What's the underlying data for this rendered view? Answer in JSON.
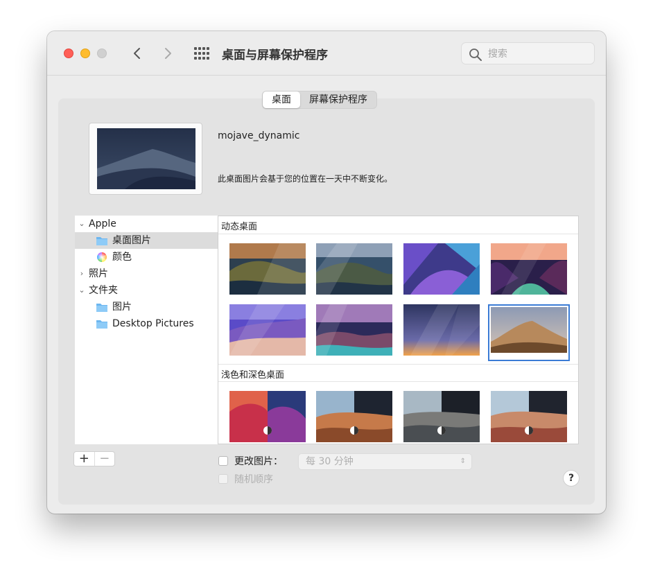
{
  "window": {
    "title": "桌面与屏幕保护程序",
    "search_placeholder": "搜索"
  },
  "tabs": [
    {
      "label": "桌面",
      "active": true
    },
    {
      "label": "屏幕保护程序",
      "active": false
    }
  ],
  "current": {
    "name": "mojave_dynamic",
    "description": "此桌面图片会基于您的位置在一天中不断变化。"
  },
  "sidebar": {
    "items": [
      {
        "label": "Apple",
        "kind": "group",
        "expanded": true,
        "icon": "chevron-down-icon"
      },
      {
        "label": "桌面图片",
        "kind": "folder",
        "selected": true,
        "icon": "folder-icon"
      },
      {
        "label": "颜色",
        "kind": "colors",
        "icon": "color-wheel-icon"
      },
      {
        "label": "照片",
        "kind": "group",
        "expanded": false,
        "icon": "chevron-right-icon"
      },
      {
        "label": "文件夹",
        "kind": "group",
        "expanded": true,
        "icon": "chevron-down-icon"
      },
      {
        "label": "图片",
        "kind": "folder",
        "icon": "folder-icon"
      },
      {
        "label": "Desktop Pictures",
        "kind": "folder",
        "icon": "folder-icon"
      }
    ]
  },
  "sections": [
    {
      "title": "动态桌面"
    },
    {
      "title": "浅色和深色桌面"
    }
  ],
  "footer": {
    "add_label": "+",
    "remove_label": "−",
    "change_picture_label": "更改图片：",
    "interval_value": "每 30 分钟",
    "random_order_label": "随机顺序",
    "help_label": "?"
  },
  "colors": {
    "close": "#ff5f57",
    "minimize": "#febc2e",
    "zoom_disabled": "#d0d0d0",
    "selection": "#3a7bd5"
  }
}
